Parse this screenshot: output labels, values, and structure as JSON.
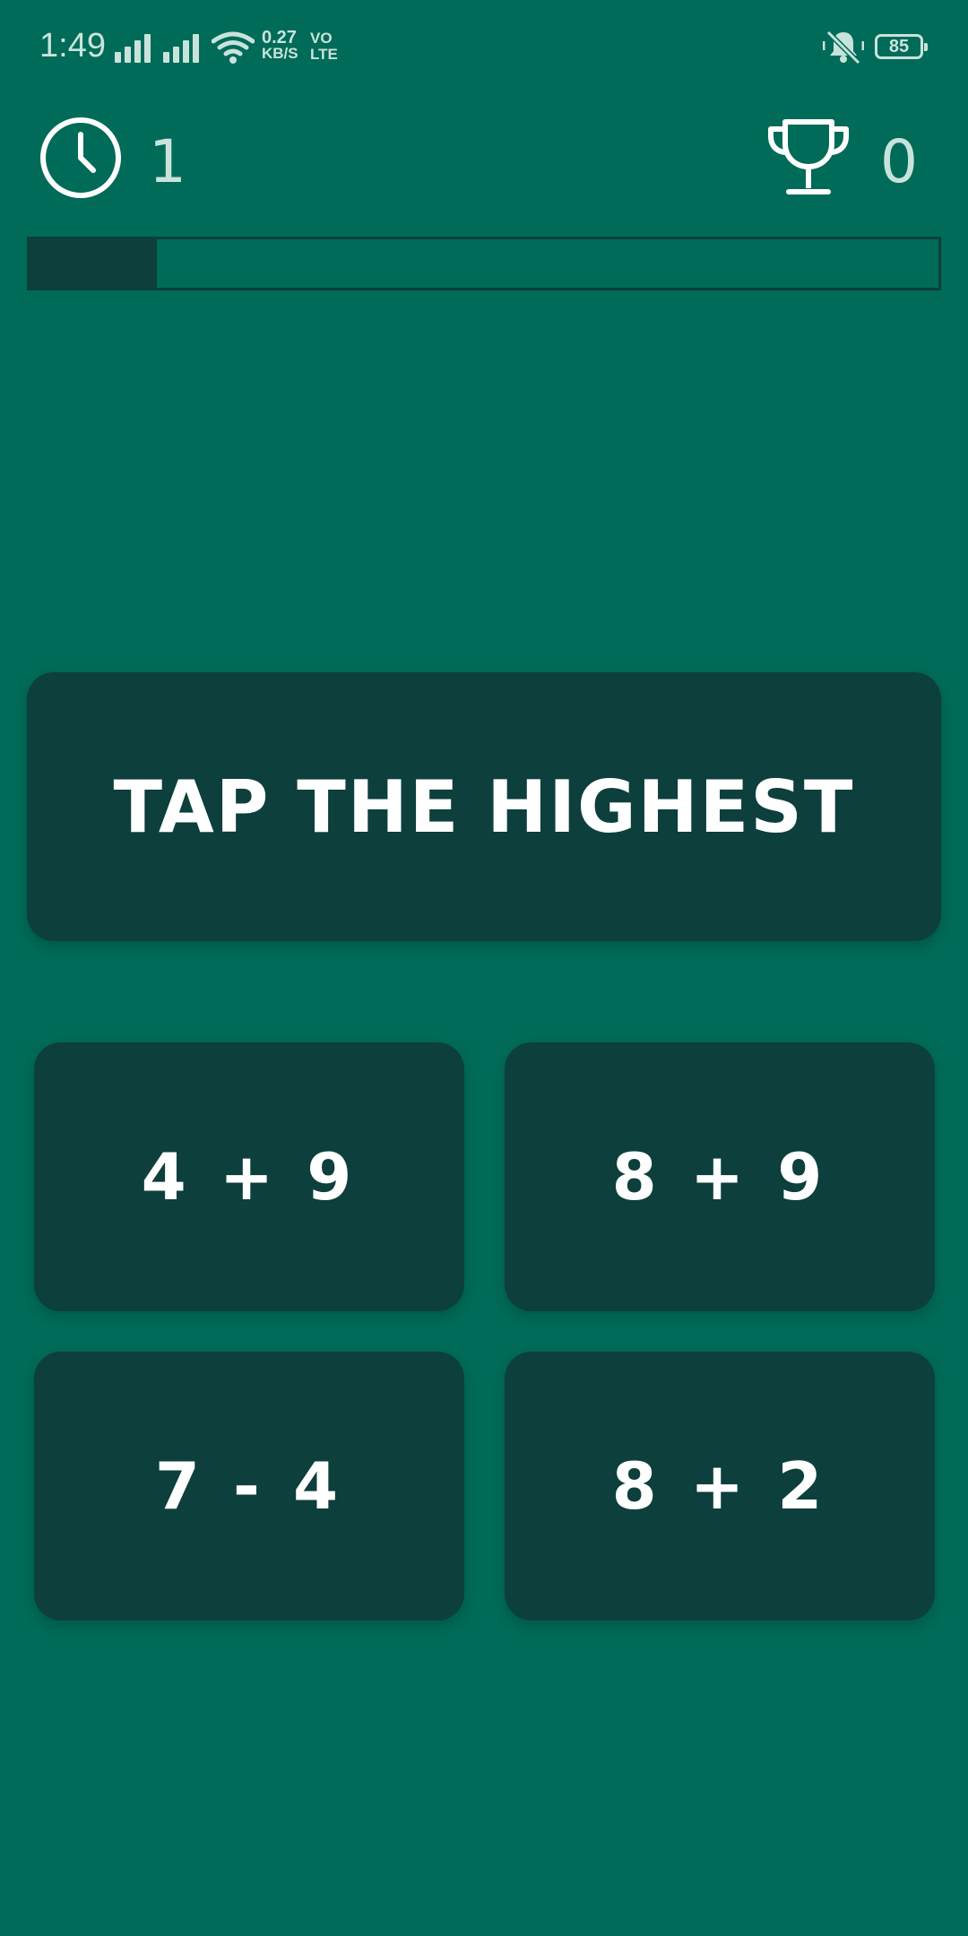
{
  "status_bar": {
    "time": "1:49",
    "net_speed_value": "0.27",
    "net_speed_unit": "KB/S",
    "volte_top": "VO",
    "volte_bottom": "LTE",
    "battery": "85"
  },
  "hud": {
    "timer": "1",
    "score": "0",
    "progress_fraction": 0.14
  },
  "instruction": "TAP THE HIGHEST",
  "answers": [
    {
      "label": "4 + 9"
    },
    {
      "label": "8 + 9"
    },
    {
      "label": "7 - 4"
    },
    {
      "label": "8 + 2"
    }
  ],
  "colors": {
    "background": "#006b58",
    "panel": "#0d3f3c",
    "text": "#ffffff",
    "muted_text": "#c9e3dc"
  },
  "icons": {
    "timer": "clock-icon",
    "score": "trophy-icon",
    "notifications": "bell-off-icon",
    "wifi": "wifi-icon",
    "signal": "signal-icon"
  }
}
